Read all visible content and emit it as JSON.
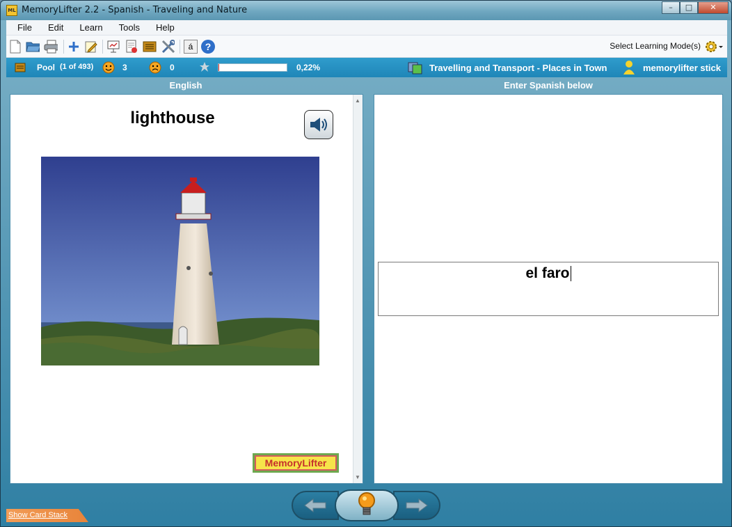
{
  "window": {
    "app_icon_text": "ML",
    "title": "MemoryLifter 2.2 - Spanish - Traveling and Nature",
    "minimize": "–",
    "maximize": "□",
    "close": "✕"
  },
  "menu": [
    "File",
    "Edit",
    "Learn",
    "Tools",
    "Help"
  ],
  "toolbar": {
    "icons": [
      "new-file-icon",
      "open-folder-icon",
      "print-icon",
      "add-card-icon",
      "edit-card-icon",
      "presentation-icon",
      "statistics-icon",
      "card-box-icon",
      "settings-tools-icon",
      "special-character-icon",
      "help-icon"
    ],
    "special_char_label": "á",
    "help_label": "?",
    "mode_label": "Select Learning Mode(s)"
  },
  "status": {
    "pool_label": "Pool",
    "pool_count": "(1 of 493)",
    "correct_count": "3",
    "wrong_count": "0",
    "progress_value": 0.0022,
    "progress_text": "0,22%",
    "chapter": "Travelling and Transport - Places in Town",
    "user": "memorylifter stick"
  },
  "left_panel": {
    "header": "English",
    "word": "lighthouse",
    "logo_text": "MemoryLifter"
  },
  "right_panel": {
    "header": "Enter Spanish below",
    "answer": "el faro"
  },
  "bottom": {
    "show_card_stack": "Show Card Stack"
  },
  "colors": {
    "status_bar": "#1f86b8",
    "progress_fill": "#e53b2b",
    "link_tab": "#f29c56"
  }
}
